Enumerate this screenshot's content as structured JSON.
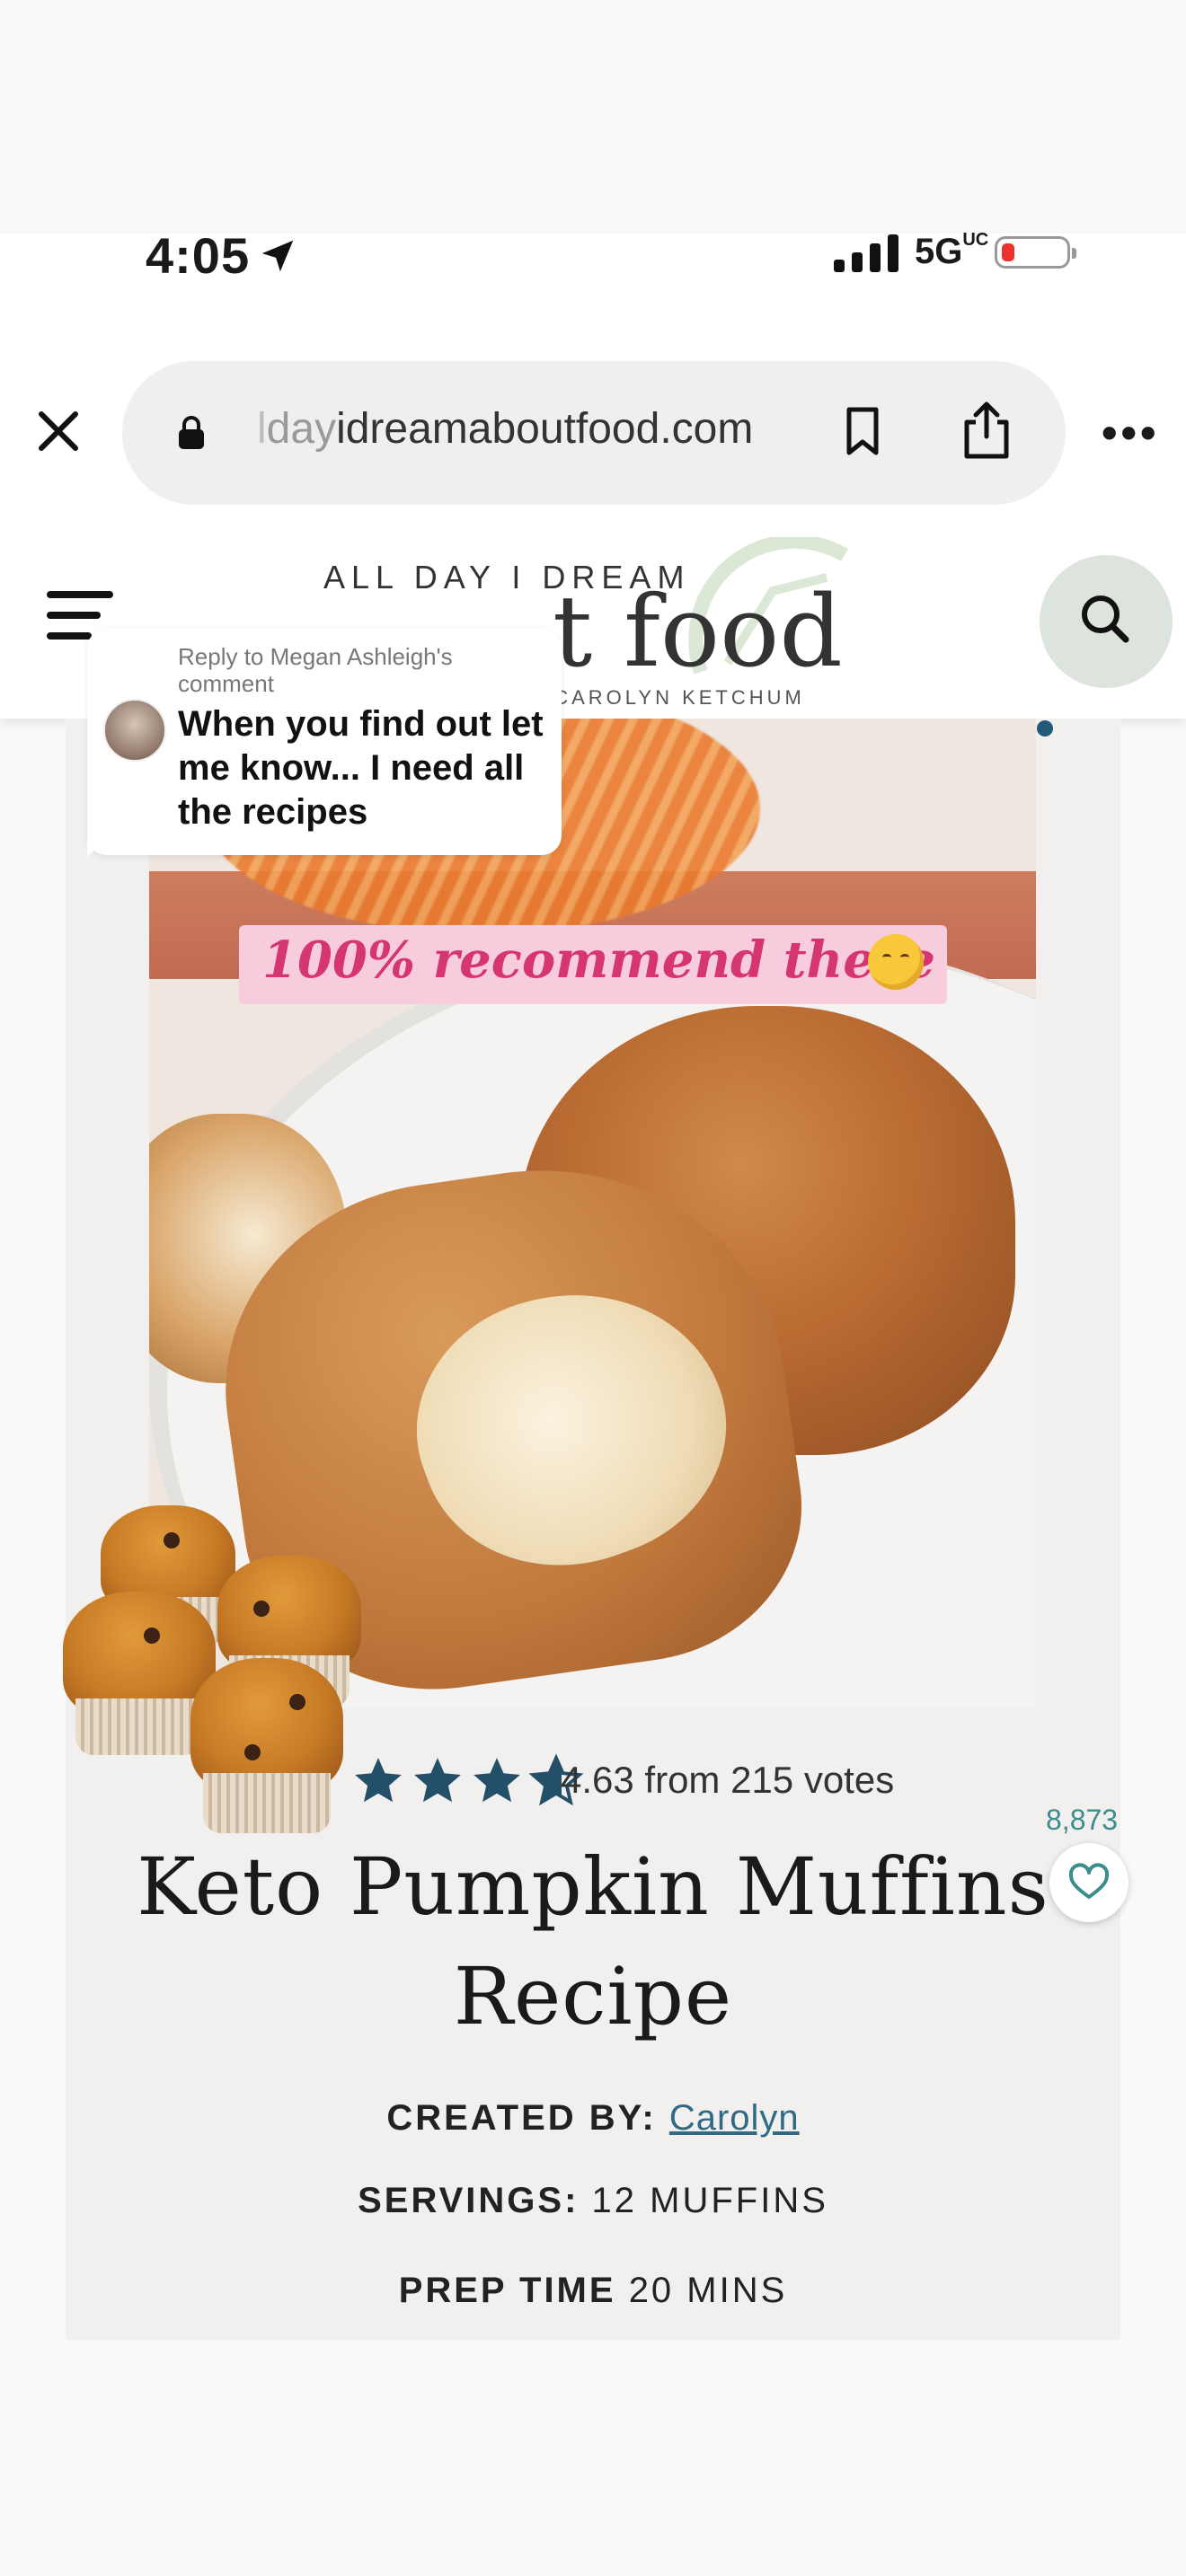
{
  "status_bar": {
    "time": "4:05",
    "network": "5G",
    "network_suffix": "UC"
  },
  "browser": {
    "url_faded": "l",
    "url_fade2": "day",
    "url_main": "idreamaboutfood.com"
  },
  "site": {
    "logo_top": "ALL DAY I DREAM",
    "logo_main": "t food",
    "logo_sub": "I CAROLYN KETCHUM"
  },
  "reply_bubble": {
    "reply_to": "Reply to Megan Ashleigh's comment",
    "text": "When you find out let me know... I need all the recipes"
  },
  "overlay_caption": "100% recommend these",
  "rating": {
    "stars_filled": 5,
    "text": "4.63 from 215 votes"
  },
  "favorites": {
    "count": "8,873"
  },
  "recipe": {
    "title_line1": "Keto Pumpkin Muffins",
    "title_line2": "Recipe",
    "created_by_label": "CREATED BY:",
    "created_by_value": "Carolyn",
    "servings_label": "SERVINGS:",
    "servings_value": "12 MUFFINS",
    "prep_label": "PREP TIME",
    "prep_value": "20 MINS"
  },
  "colors": {
    "accent_teal": "#235a7a",
    "caption_pink": "#d5366f",
    "caption_bg": "#f7cddd",
    "link": "#2f6b85"
  }
}
